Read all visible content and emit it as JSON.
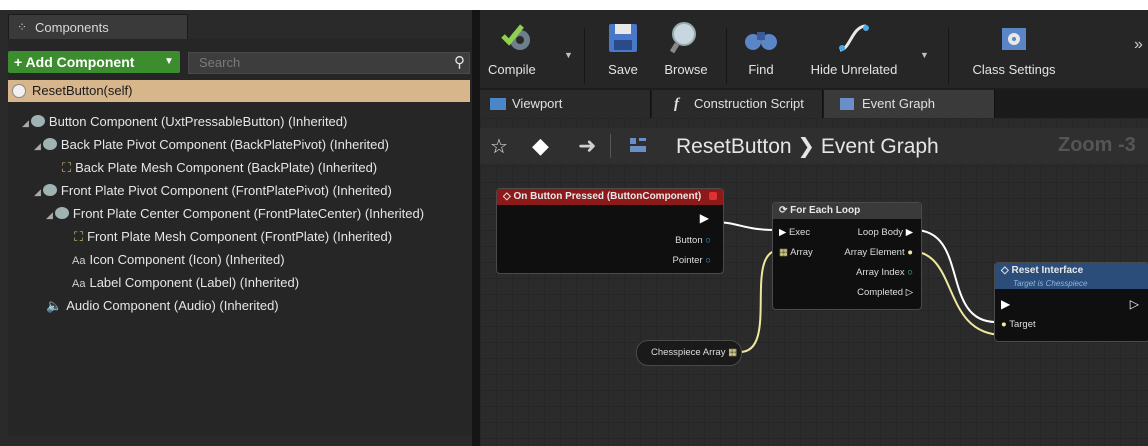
{
  "components_panel": {
    "tab_title": "Components",
    "add_button": "+ Add Component",
    "search_placeholder": "Search",
    "selected_item": "ResetButton(self)",
    "tree": [
      {
        "label": "Button Component (UxtPressableButton) (Inherited)",
        "icon": "gear-icon"
      },
      {
        "label": "Back Plate Pivot Component (BackPlatePivot) (Inherited)",
        "icon": "gear-icon"
      },
      {
        "label": "Back Plate Mesh Component (BackPlate) (Inherited)",
        "icon": "mesh-icon"
      },
      {
        "label": "Front Plate Pivot Component (FrontPlatePivot) (Inherited)",
        "icon": "gear-icon"
      },
      {
        "label": "Front Plate Center Component (FrontPlateCenter) (Inherited)",
        "icon": "gear-icon"
      },
      {
        "label": "Front Plate Mesh Component (FrontPlate) (Inherited)",
        "icon": "mesh-icon"
      },
      {
        "label": "Icon Component (Icon) (Inherited)",
        "icon": "text-icon"
      },
      {
        "label": "Label Component (Label) (Inherited)",
        "icon": "text-icon"
      },
      {
        "label": "Audio Component (Audio) (Inherited)",
        "icon": "speaker-icon"
      }
    ]
  },
  "toolbar": {
    "compile": "Compile",
    "save": "Save",
    "browse": "Browse",
    "find": "Find",
    "hide_unrelated": "Hide Unrelated",
    "class_settings": "Class Settings"
  },
  "tabs": [
    "Viewport",
    "Construction Script",
    "Event Graph"
  ],
  "graph": {
    "breadcrumb": "ResetButton ❯ Event Graph",
    "zoom": "Zoom -3",
    "nodes": {
      "on_pressed": {
        "title": "On Button Pressed (ButtonComponent)",
        "button": "Button",
        "pointer": "Pointer"
      },
      "for_each": {
        "title": "For Each Loop",
        "exec": "Exec",
        "array": "Array",
        "loop_body": "Loop Body",
        "array_element": "Array Element",
        "array_index": "Array Index",
        "completed": "Completed"
      },
      "chesspiece": {
        "title": "Chesspiece Array"
      },
      "reset": {
        "title": "Reset Interface",
        "subtitle": "Target is Chesspiece",
        "target": "Target"
      }
    }
  },
  "colors": {
    "add_button": "#3b8d2e",
    "selection": "#d8b68c",
    "event_header": "#8c1a1a",
    "function_header": "#2a4d7a",
    "exec_wire": "#ffffff",
    "object_pin": "#3fa9e8",
    "array_pin": "#f0e89a"
  }
}
